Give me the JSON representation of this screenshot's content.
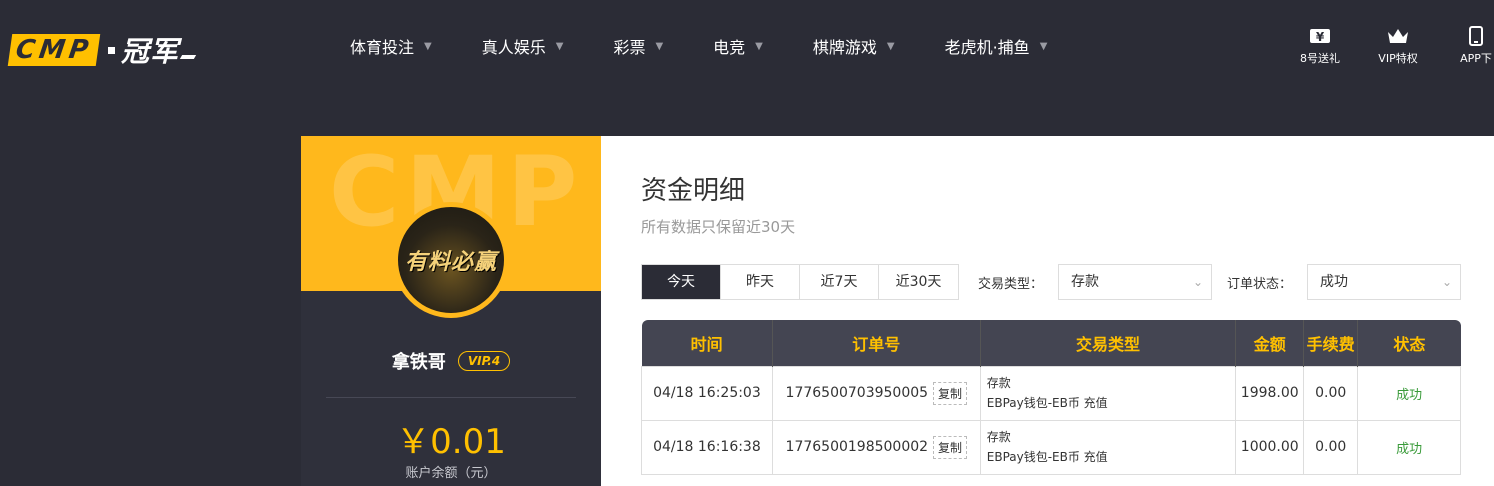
{
  "header": {
    "logo_box": "CMP",
    "logo_cn": "冠军",
    "nav": [
      "体育投注",
      "真人娱乐",
      "彩票",
      "电竞",
      "棋牌游戏",
      "老虎机·捕鱼"
    ],
    "tools": [
      {
        "label": "8号送礼",
        "icon": "gift-ticket-icon"
      },
      {
        "label": "VIP特权",
        "icon": "crown-icon"
      },
      {
        "label": "APP下",
        "icon": "phone-icon"
      }
    ]
  },
  "sidebar": {
    "watermark": "CMP",
    "avatar_text": "有料必赢",
    "username": "拿铁哥",
    "vip": "VIP.4",
    "balance": "￥0.01",
    "balance_label": "账户余额（元）"
  },
  "main": {
    "title": "资金明细",
    "subtitle": "所有数据只保留近30天",
    "tabs": [
      "今天",
      "昨天",
      "近7天",
      "近30天"
    ],
    "active_tab": "今天",
    "type_filter": {
      "label": "交易类型：",
      "value": "存款"
    },
    "status_filter": {
      "label": "订单状态：",
      "value": "成功"
    },
    "table": {
      "headers": [
        "时间",
        "订单号",
        "交易类型",
        "金额",
        "手续费",
        "状态"
      ],
      "copy_label": "复制",
      "rows": [
        {
          "time": "04/18 16:25:03",
          "order": "1776500703950005",
          "type_main": "存款",
          "type_sub": "EBPay钱包-EB币 充值",
          "amount": "1998.00",
          "fee": "0.00",
          "status": "成功"
        },
        {
          "time": "04/18 16:16:38",
          "order": "1776500198500002",
          "type_main": "存款",
          "type_sub": "EBPay钱包-EB币 充值",
          "amount": "1000.00",
          "fee": "0.00",
          "status": "成功"
        }
      ]
    }
  }
}
